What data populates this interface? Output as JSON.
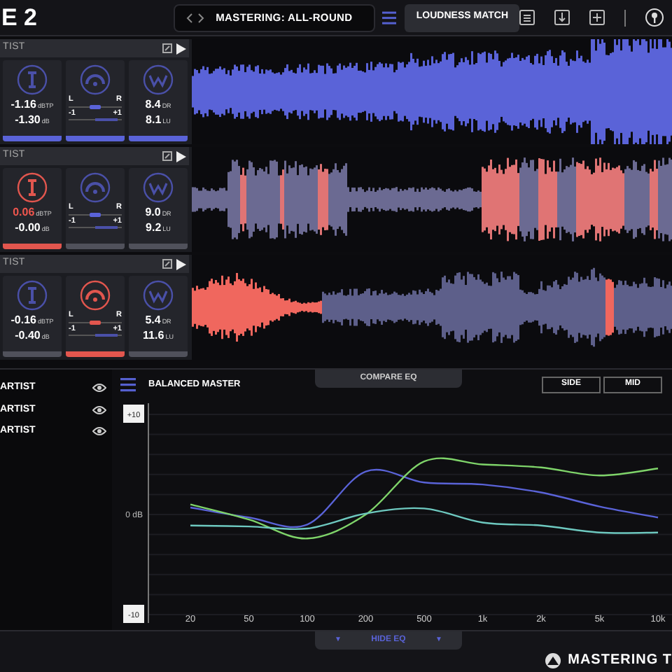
{
  "title": "E 2",
  "preset": "MASTERING: ALL-ROUND",
  "loudness_tab": {
    "label": "LOUDNESS MATCH",
    "selected": false
  },
  "tracks": [
    {
      "name": "TIST",
      "selected": true,
      "peak": {
        "true_peak": "-1.16",
        "tp_unit": "dBTP",
        "gain": "-1.30",
        "gain_unit": "dB",
        "alert": false
      },
      "stereo": {
        "l": "L",
        "r": "R",
        "min": "-1",
        "max": "+1",
        "alert": false
      },
      "dynamics": {
        "dr": "8.4",
        "dr_unit": "DR",
        "lu": "8.1",
        "lu_unit": "LU",
        "alert": false
      }
    },
    {
      "name": "TIST",
      "selected": false,
      "peak": {
        "true_peak": "0.06",
        "tp_unit": "dBTP",
        "gain": "-0.00",
        "gain_unit": "dB",
        "alert": true
      },
      "stereo": {
        "l": "L",
        "r": "R",
        "min": "-1",
        "max": "+1",
        "alert": false
      },
      "dynamics": {
        "dr": "9.0",
        "dr_unit": "DR",
        "lu": "9.2",
        "lu_unit": "LU",
        "alert": false
      }
    },
    {
      "name": "TIST",
      "selected": false,
      "peak": {
        "true_peak": "-0.16",
        "tp_unit": "dBTP",
        "gain": "-0.40",
        "gain_unit": "dB",
        "alert": false
      },
      "stereo": {
        "l": "L",
        "r": "R",
        "min": "-1",
        "max": "+1",
        "alert": true
      },
      "dynamics": {
        "dr": "5.4",
        "dr_unit": "DR",
        "lu": "11.6",
        "lu_unit": "LU",
        "alert": false
      }
    }
  ],
  "eq_list": [
    {
      "name": "ARTIST",
      "visible": true
    },
    {
      "name": "ARTIST",
      "visible": true
    },
    {
      "name": "ARTIST",
      "visible": true
    }
  ],
  "eq": {
    "title": "BALANCED MASTER",
    "compare_tab": "COMPARE EQ",
    "modes": [
      {
        "label": "SIDE",
        "selected": false
      },
      {
        "label": "MID",
        "selected": false
      }
    ],
    "chart_data": {
      "type": "line",
      "categories": [
        "20",
        "50",
        "100",
        "200",
        "500",
        "1k",
        "2k",
        "5k",
        "10k"
      ],
      "ylim": [
        -10,
        10
      ],
      "yticks": [
        {
          "value": 10,
          "label": "+10"
        },
        {
          "value": 0,
          "label": "0 dB"
        },
        {
          "value": -10,
          "label": "-10"
        }
      ],
      "series": [
        {
          "color": "#5a63d8",
          "values": [
            0.7,
            -0.3,
            -1,
            4.3,
            3.2,
            3,
            2.2,
            0.8,
            -0.3
          ]
        },
        {
          "color": "#7fd46a",
          "values": [
            1,
            -0.5,
            -2.4,
            0,
            5.3,
            5,
            4.7,
            3.9,
            4.6
          ]
        },
        {
          "color": "#6ec9c0",
          "values": [
            -1.1,
            -1.2,
            -1.4,
            0.1,
            0.6,
            -0.8,
            -1.1,
            -1.8,
            -1.8
          ]
        }
      ]
    }
  },
  "footer": {
    "hide_eq": "HIDE EQ",
    "arrow": "▼",
    "brand": "MASTERING T"
  }
}
